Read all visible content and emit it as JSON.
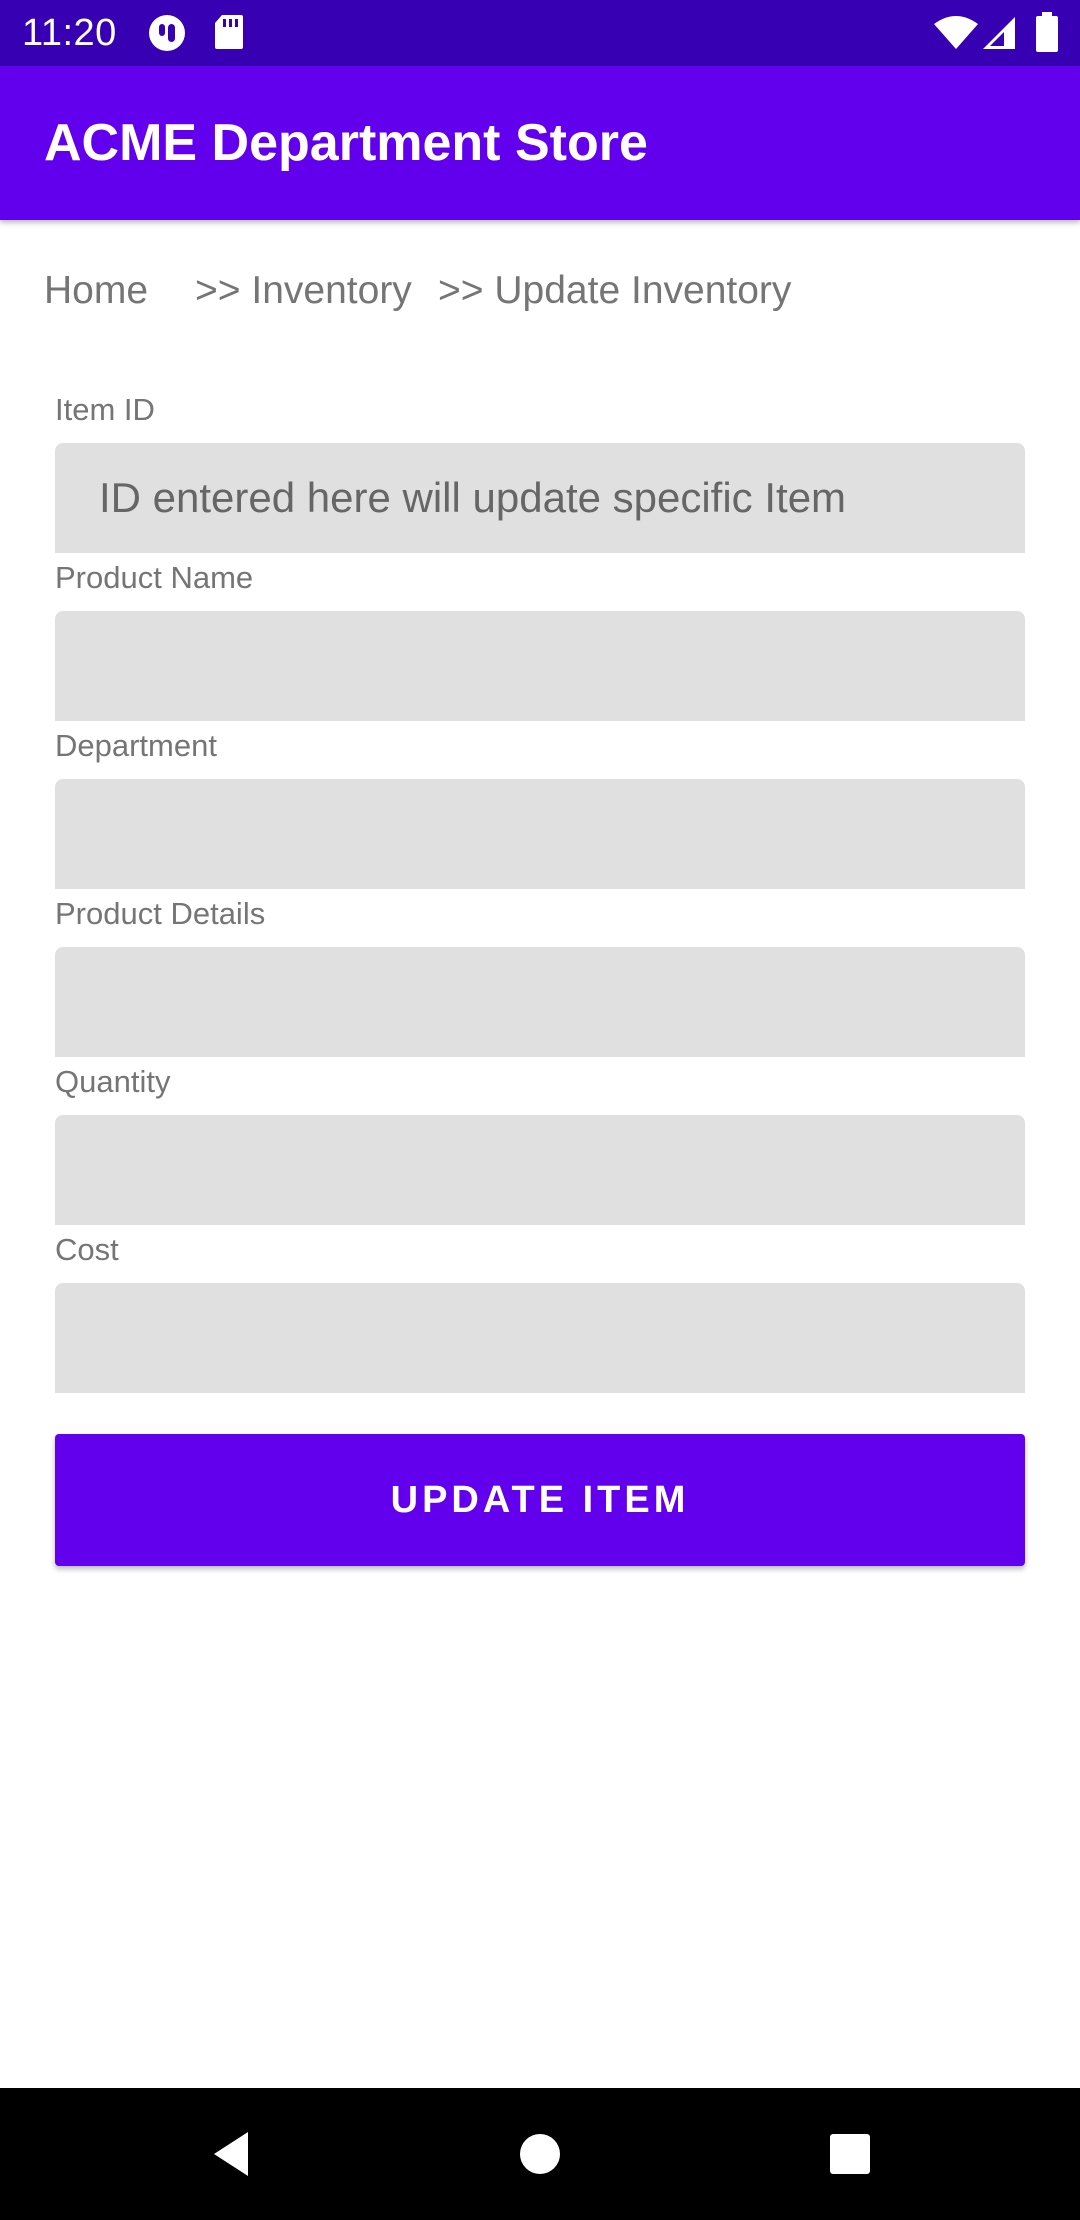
{
  "status_bar": {
    "time": "11:20",
    "icons": [
      "notification-app-icon",
      "sd-card-icon",
      "wifi-icon",
      "cellular-signal-icon",
      "battery-icon"
    ],
    "background": "#3700b3"
  },
  "app_bar": {
    "title": "ACME Department Store",
    "background": "#6200ee"
  },
  "breadcrumb": {
    "home": "Home",
    "inventory": ">> Inventory",
    "update_inventory": ">> Update Inventory"
  },
  "form": {
    "item_id": {
      "label": "Item ID",
      "placeholder": "ID entered here will update specific Item",
      "value": ""
    },
    "product_name": {
      "label": "Product Name",
      "placeholder": "",
      "value": ""
    },
    "department": {
      "label": "Department",
      "placeholder": "",
      "value": ""
    },
    "product_details": {
      "label": "Product Details",
      "placeholder": "",
      "value": ""
    },
    "quantity": {
      "label": "Quantity",
      "placeholder": "",
      "value": ""
    },
    "cost": {
      "label": "Cost",
      "placeholder": "",
      "value": ""
    },
    "submit_label": "UPDATE ITEM",
    "submit_color": "#6200ee"
  },
  "nav_bar": {
    "icons": [
      "back-icon",
      "home-icon",
      "recents-icon"
    ]
  }
}
